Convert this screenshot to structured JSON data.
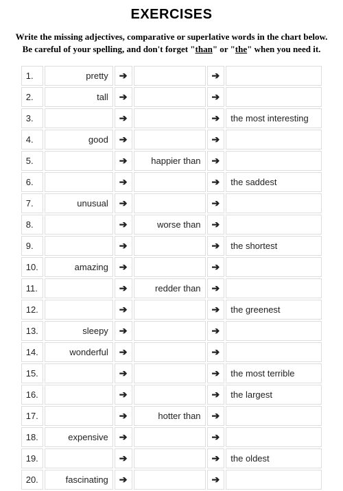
{
  "title": "EXERCISES",
  "instructions_line1": "Write the missing adjectives, comparative or superlative words in the chart below.",
  "instructions_line2a": "Be careful of your spelling, and don't forget \"",
  "instructions_than": "than",
  "instructions_line2b": "\" or \"",
  "instructions_the": "the",
  "instructions_line2c": "\" when you need it.",
  "arrow": "➔",
  "rows": [
    {
      "n": "1.",
      "positive": "pretty",
      "comparative": "",
      "superlative": ""
    },
    {
      "n": "2.",
      "positive": "tall",
      "comparative": "",
      "superlative": ""
    },
    {
      "n": "3.",
      "positive": "",
      "comparative": "",
      "superlative": "the most interesting"
    },
    {
      "n": "4.",
      "positive": "good",
      "comparative": "",
      "superlative": ""
    },
    {
      "n": "5.",
      "positive": "",
      "comparative": "happier than",
      "superlative": ""
    },
    {
      "n": "6.",
      "positive": "",
      "comparative": "",
      "superlative": "the saddest"
    },
    {
      "n": "7.",
      "positive": "unusual",
      "comparative": "",
      "superlative": ""
    },
    {
      "n": "8.",
      "positive": "",
      "comparative": "worse than",
      "superlative": ""
    },
    {
      "n": "9.",
      "positive": "",
      "comparative": "",
      "superlative": "the shortest"
    },
    {
      "n": "10.",
      "positive": "amazing",
      "comparative": "",
      "superlative": ""
    },
    {
      "n": "11.",
      "positive": "",
      "comparative": "redder than",
      "superlative": ""
    },
    {
      "n": "12.",
      "positive": "",
      "comparative": "",
      "superlative": "the greenest"
    },
    {
      "n": "13.",
      "positive": "sleepy",
      "comparative": "",
      "superlative": ""
    },
    {
      "n": "14.",
      "positive": "wonderful",
      "comparative": "",
      "superlative": ""
    },
    {
      "n": "15.",
      "positive": "",
      "comparative": "",
      "superlative": "the most terrible"
    },
    {
      "n": "16.",
      "positive": "",
      "comparative": "",
      "superlative": "the largest"
    },
    {
      "n": "17.",
      "positive": "",
      "comparative": "hotter than",
      "superlative": ""
    },
    {
      "n": "18.",
      "positive": "expensive",
      "comparative": "",
      "superlative": ""
    },
    {
      "n": "19.",
      "positive": "",
      "comparative": "",
      "superlative": "the oldest"
    },
    {
      "n": "20.",
      "positive": "fascinating",
      "comparative": "",
      "superlative": ""
    }
  ]
}
